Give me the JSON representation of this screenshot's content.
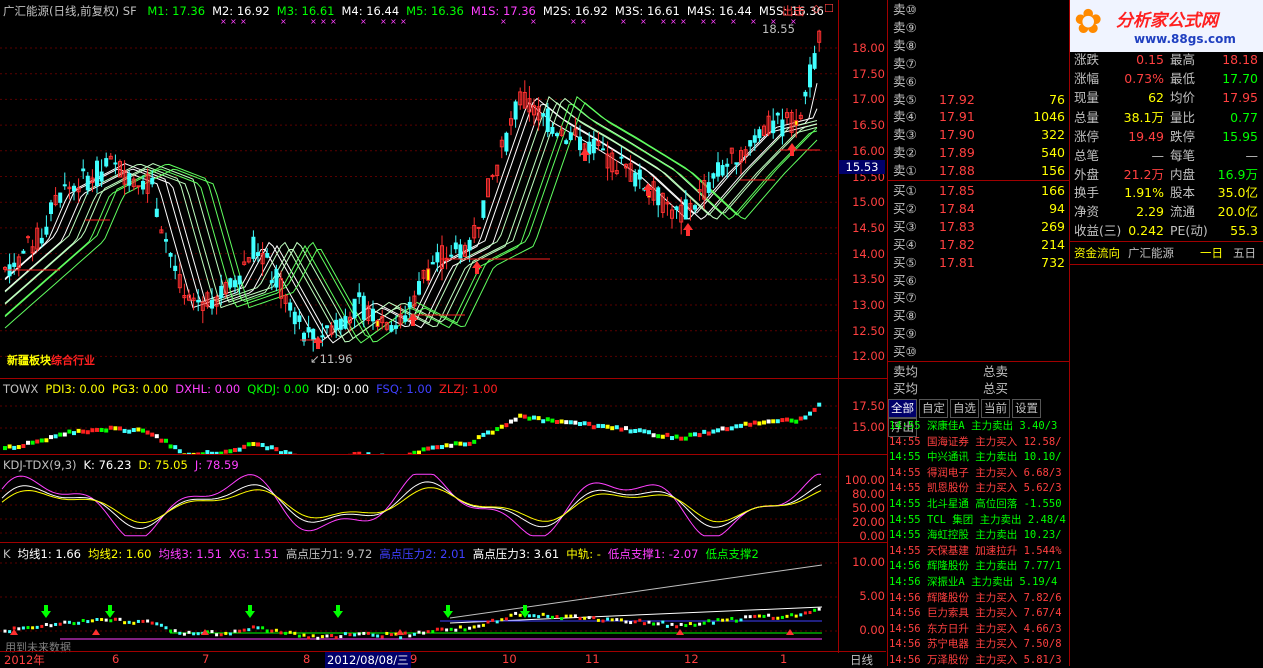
{
  "main_chart": {
    "title": "广汇能源(日线,前复权) SF",
    "ma": [
      {
        "label": "M1: 17.36",
        "color": "#00ff00"
      },
      {
        "label": "M2: 16.92",
        "color": "#ffffff"
      },
      {
        "label": "M3: 16.61",
        "color": "#00ff00"
      },
      {
        "label": "M4: 16.44",
        "color": "#ffffff"
      },
      {
        "label": "M5: 16.36",
        "color": "#00ff00"
      },
      {
        "label": "M1S: 17.36",
        "color": "#ff40ff"
      },
      {
        "label": "M2S: 16.92",
        "color": "#ffffff"
      },
      {
        "label": "M3S: 16.61",
        "color": "#ffffff"
      },
      {
        "label": "M4S: 16.44",
        "color": "#ffffff"
      },
      {
        "label": "M5S: 16.36",
        "color": "#ffffff"
      }
    ],
    "exit_label": "出击",
    "high_label": "18.55",
    "low_label": "11.96",
    "current_price_tag": "15.53",
    "sector_label_1": "新疆板块",
    "sector_label_2": "综合行业",
    "y_ticks": [
      "18.00",
      "17.50",
      "17.00",
      "16.50",
      "16.00",
      "15.50",
      "15.00",
      "14.50",
      "14.00",
      "13.50",
      "13.00",
      "12.50",
      "12.00"
    ]
  },
  "towx": {
    "items": [
      {
        "label": "TOWX",
        "color": "#c0c0c0"
      },
      {
        "label": "PDI3: 0.00",
        "color": "#ffff00"
      },
      {
        "label": "PG3: 0.00",
        "color": "#ffff00"
      },
      {
        "label": "DXHL: 0.00",
        "color": "#ff40ff"
      },
      {
        "label": "QKDJ: 0.00",
        "color": "#00ff00"
      },
      {
        "label": "KDJ: 0.00",
        "color": "#ffffff"
      },
      {
        "label": "FSQ: 1.00",
        "color": "#4040ff"
      },
      {
        "label": "ZLZJ: 1.00",
        "color": "#ff2020"
      }
    ],
    "y_ticks": [
      "17.50",
      "15.00"
    ]
  },
  "kdj": {
    "items": [
      {
        "label": "KDJ-TDX(9,3)",
        "color": "#c0c0c0"
      },
      {
        "label": "K: 76.23",
        "color": "#ffffff"
      },
      {
        "label": "D: 75.05",
        "color": "#ffff00"
      },
      {
        "label": "J: 78.59",
        "color": "#ff40ff"
      }
    ],
    "y_ticks": [
      "100.00",
      "80.00",
      "50.00",
      "20.00",
      "0.00"
    ]
  },
  "k_ind": {
    "items": [
      {
        "label": "K",
        "color": "#c0c0c0"
      },
      {
        "label": "均线1: 1.66",
        "color": "#ffffff"
      },
      {
        "label": "均线2: 1.60",
        "color": "#ffff00"
      },
      {
        "label": "均线3: 1.51",
        "color": "#ff40ff"
      },
      {
        "label": "XG: 1.51",
        "color": "#ff40ff"
      },
      {
        "label": "高点压力1: 9.72",
        "color": "#c0c0c0"
      },
      {
        "label": "高点压力2: 2.01",
        "color": "#4040ff"
      },
      {
        "label": "高点压力3: 3.61",
        "color": "#ffffff"
      },
      {
        "label": "中轨: -",
        "color": "#ffff00"
      },
      {
        "label": "低点支撑1: -2.07",
        "color": "#ff40ff"
      },
      {
        "label": "低点支撑2",
        "color": "#00ff00"
      }
    ],
    "note": "用到未来数据",
    "y_ticks": [
      "10.00",
      "5.00",
      "0.00"
    ]
  },
  "x_axis": {
    "labels": [
      "2012年",
      "6",
      "7",
      "8",
      "2012/08/08/三",
      "9",
      "10",
      "11",
      "12",
      "1"
    ],
    "period": "日线"
  },
  "order_book": {
    "sells": [
      {
        "label": "卖⑩",
        "price": "",
        "vol": ""
      },
      {
        "label": "卖⑨",
        "price": "",
        "vol": ""
      },
      {
        "label": "卖⑧",
        "price": "",
        "vol": ""
      },
      {
        "label": "卖⑦",
        "price": "",
        "vol": ""
      },
      {
        "label": "卖⑥",
        "price": "",
        "vol": ""
      },
      {
        "label": "卖⑤",
        "price": "17.92",
        "vol": "76"
      },
      {
        "label": "卖④",
        "price": "17.91",
        "vol": "1046"
      },
      {
        "label": "卖③",
        "price": "17.90",
        "vol": "322"
      },
      {
        "label": "卖②",
        "price": "17.89",
        "vol": "540"
      },
      {
        "label": "卖①",
        "price": "17.88",
        "vol": "156"
      }
    ],
    "buys": [
      {
        "label": "买①",
        "price": "17.85",
        "vol": "166"
      },
      {
        "label": "买②",
        "price": "17.84",
        "vol": "94"
      },
      {
        "label": "买③",
        "price": "17.83",
        "vol": "269"
      },
      {
        "label": "买④",
        "price": "17.82",
        "vol": "214"
      },
      {
        "label": "买⑤",
        "price": "17.81",
        "vol": "732"
      },
      {
        "label": "买⑥",
        "price": "",
        "vol": ""
      },
      {
        "label": "买⑦",
        "price": "",
        "vol": ""
      },
      {
        "label": "买⑧",
        "price": "",
        "vol": ""
      },
      {
        "label": "买⑨",
        "price": "",
        "vol": ""
      },
      {
        "label": "买⑩",
        "price": "",
        "vol": ""
      }
    ],
    "avg_sell": "卖均",
    "avg_buy": "买均",
    "total_sell": "总卖",
    "total_buy": "总买"
  },
  "tabs": [
    "全部",
    "自定",
    "自选",
    "当前",
    "设置",
    "浮出"
  ],
  "ticker": [
    {
      "time": "14:55",
      "name": "深康佳A",
      "act": "主力卖出",
      "val": "3.40/3",
      "c": "#00ff00"
    },
    {
      "time": "14:55",
      "name": "国海证券",
      "act": "主力买入",
      "val": "12.58/",
      "c": "#ff4040"
    },
    {
      "time": "14:55",
      "name": "中兴通讯",
      "act": "主力卖出",
      "val": "10.10/",
      "c": "#00ff00"
    },
    {
      "time": "14:55",
      "name": "得润电子",
      "act": "主力买入",
      "val": "6.68/3",
      "c": "#ff4040"
    },
    {
      "time": "14:55",
      "name": "凯恩股份",
      "act": "主力买入",
      "val": "5.62/3",
      "c": "#ff4040"
    },
    {
      "time": "14:55",
      "name": "北斗星通",
      "act": "高位回落",
      "val": "-1.550",
      "c": "#00ff00"
    },
    {
      "time": "14:55",
      "name": "TCL 集团",
      "act": "主力卖出",
      "val": "2.48/4",
      "c": "#00ff00"
    },
    {
      "time": "14:55",
      "name": "海虹控股",
      "act": "主力卖出",
      "val": "10.23/",
      "c": "#00ff00"
    },
    {
      "time": "14:55",
      "name": "天保基建",
      "act": "加速拉升",
      "val": "1.544%",
      "c": "#ff4040"
    },
    {
      "time": "14:56",
      "name": "辉隆股份",
      "act": "主力卖出",
      "val": "7.77/1",
      "c": "#00ff00"
    },
    {
      "time": "14:56",
      "name": "深振业A",
      "act": "主力卖出",
      "val": "5.19/4",
      "c": "#00ff00"
    },
    {
      "time": "14:56",
      "name": "辉隆股份",
      "act": "主力买入",
      "val": "7.82/6",
      "c": "#ff4040"
    },
    {
      "time": "14:56",
      "name": "巨力索具",
      "act": "主力买入",
      "val": "7.67/4",
      "c": "#ff4040"
    },
    {
      "time": "14:56",
      "name": "东方日升",
      "act": "主力买入",
      "val": "4.66/3",
      "c": "#ff4040"
    },
    {
      "time": "14:56",
      "name": "苏宁电器",
      "act": "主力买入",
      "val": "7.50/8",
      "c": "#ff4040"
    },
    {
      "time": "14:56",
      "name": "万泽股份",
      "act": "主力买入",
      "val": "5.81/3",
      "c": "#ff4040"
    }
  ],
  "logo": {
    "title": "分析家公式网",
    "url": "www.88gs.com"
  },
  "stats": [
    {
      "l1": "涨跌",
      "v1": "0.15",
      "l2": "最高",
      "v2": "18.18",
      "c1": "#ff4040",
      "c2": "#ff4040"
    },
    {
      "l1": "涨幅",
      "v1": "0.73%",
      "l2": "最低",
      "v2": "17.70",
      "c1": "#ff4040",
      "c2": "#00ff00"
    },
    {
      "l1": "现量",
      "v1": "62",
      "l2": "均价",
      "v2": "17.95",
      "c1": "#ffff00",
      "c2": "#ff4040"
    },
    {
      "l1": "总量",
      "v1": "38.1万",
      "l2": "量比",
      "v2": "0.77",
      "c1": "#ffff00",
      "c2": "#00ff00"
    },
    {
      "l1": "涨停",
      "v1": "19.49",
      "l2": "跌停",
      "v2": "15.95",
      "c1": "#ff4040",
      "c2": "#00ff00"
    },
    {
      "l1": "总笔",
      "v1": "—",
      "l2": "每笔",
      "v2": "—",
      "c1": "#c0c0c0",
      "c2": "#c0c0c0"
    },
    {
      "l1": "外盘",
      "v1": "21.2万",
      "l2": "内盘",
      "v2": "16.9万",
      "c1": "#ff4040",
      "c2": "#00ff00"
    },
    {
      "l1": "换手",
      "v1": "1.91%",
      "l2": "股本",
      "v2": "35.0亿",
      "c1": "#ffff00",
      "c2": "#ffff00"
    },
    {
      "l1": "净资",
      "v1": "2.29",
      "l2": "流通",
      "v2": "20.0亿",
      "c1": "#ffff00",
      "c2": "#ffff00"
    },
    {
      "l1": "收益(三)",
      "v1": "0.242",
      "l2": "PE(动)",
      "v2": "55.3",
      "c1": "#ffff00",
      "c2": "#ffff00"
    }
  ],
  "flow": {
    "label": "资金流向",
    "name": "广汇能源",
    "btn1": "一日",
    "btn2": "五日"
  }
}
